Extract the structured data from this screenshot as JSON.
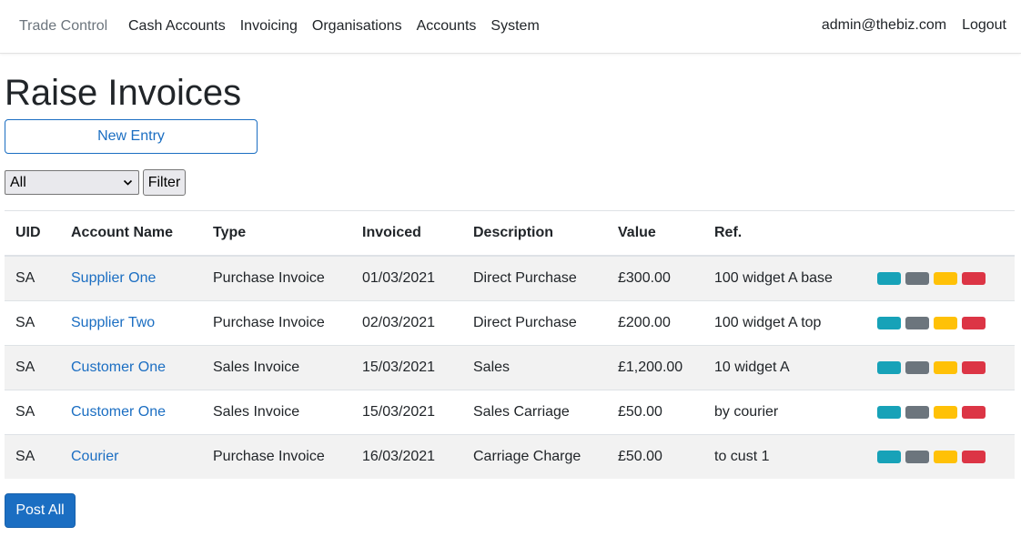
{
  "nav": {
    "brand": "Trade Control",
    "items": [
      {
        "label": "Cash Accounts"
      },
      {
        "label": "Invoicing"
      },
      {
        "label": "Organisations"
      },
      {
        "label": "Accounts"
      },
      {
        "label": "System"
      }
    ],
    "user": "admin@thebiz.com",
    "logout": "Logout"
  },
  "page": {
    "title": "Raise Invoices",
    "new_entry": "New Entry",
    "filter_value": "All",
    "filter_button": "Filter",
    "post_all": "Post All"
  },
  "table": {
    "headers": [
      "UID",
      "Account Name",
      "Type",
      "Invoiced",
      "Description",
      "Value",
      "Ref."
    ],
    "rows": [
      {
        "uid": "SA",
        "account": "Supplier One",
        "type": "Purchase Invoice",
        "invoiced": "01/03/2021",
        "description": "Direct Purchase",
        "value": "£300.00",
        "ref": "100 widget A base"
      },
      {
        "uid": "SA",
        "account": "Supplier Two",
        "type": "Purchase Invoice",
        "invoiced": "02/03/2021",
        "description": "Direct Purchase",
        "value": "£200.00",
        "ref": "100 widget A top"
      },
      {
        "uid": "SA",
        "account": "Customer One",
        "type": "Sales Invoice",
        "invoiced": "15/03/2021",
        "description": "Sales",
        "value": "£1,200.00",
        "ref": "10 widget A"
      },
      {
        "uid": "SA",
        "account": "Customer One",
        "type": "Sales Invoice",
        "invoiced": "15/03/2021",
        "description": "Sales Carriage",
        "value": "£50.00",
        "ref": "by courier"
      },
      {
        "uid": "SA",
        "account": "Courier",
        "type": "Purchase Invoice",
        "invoiced": "16/03/2021",
        "description": "Carriage Charge",
        "value": "£50.00",
        "ref": "to cust 1"
      }
    ],
    "action_colors": [
      "#17a2b8",
      "#6c757d",
      "#ffc107",
      "#dc3545"
    ]
  }
}
